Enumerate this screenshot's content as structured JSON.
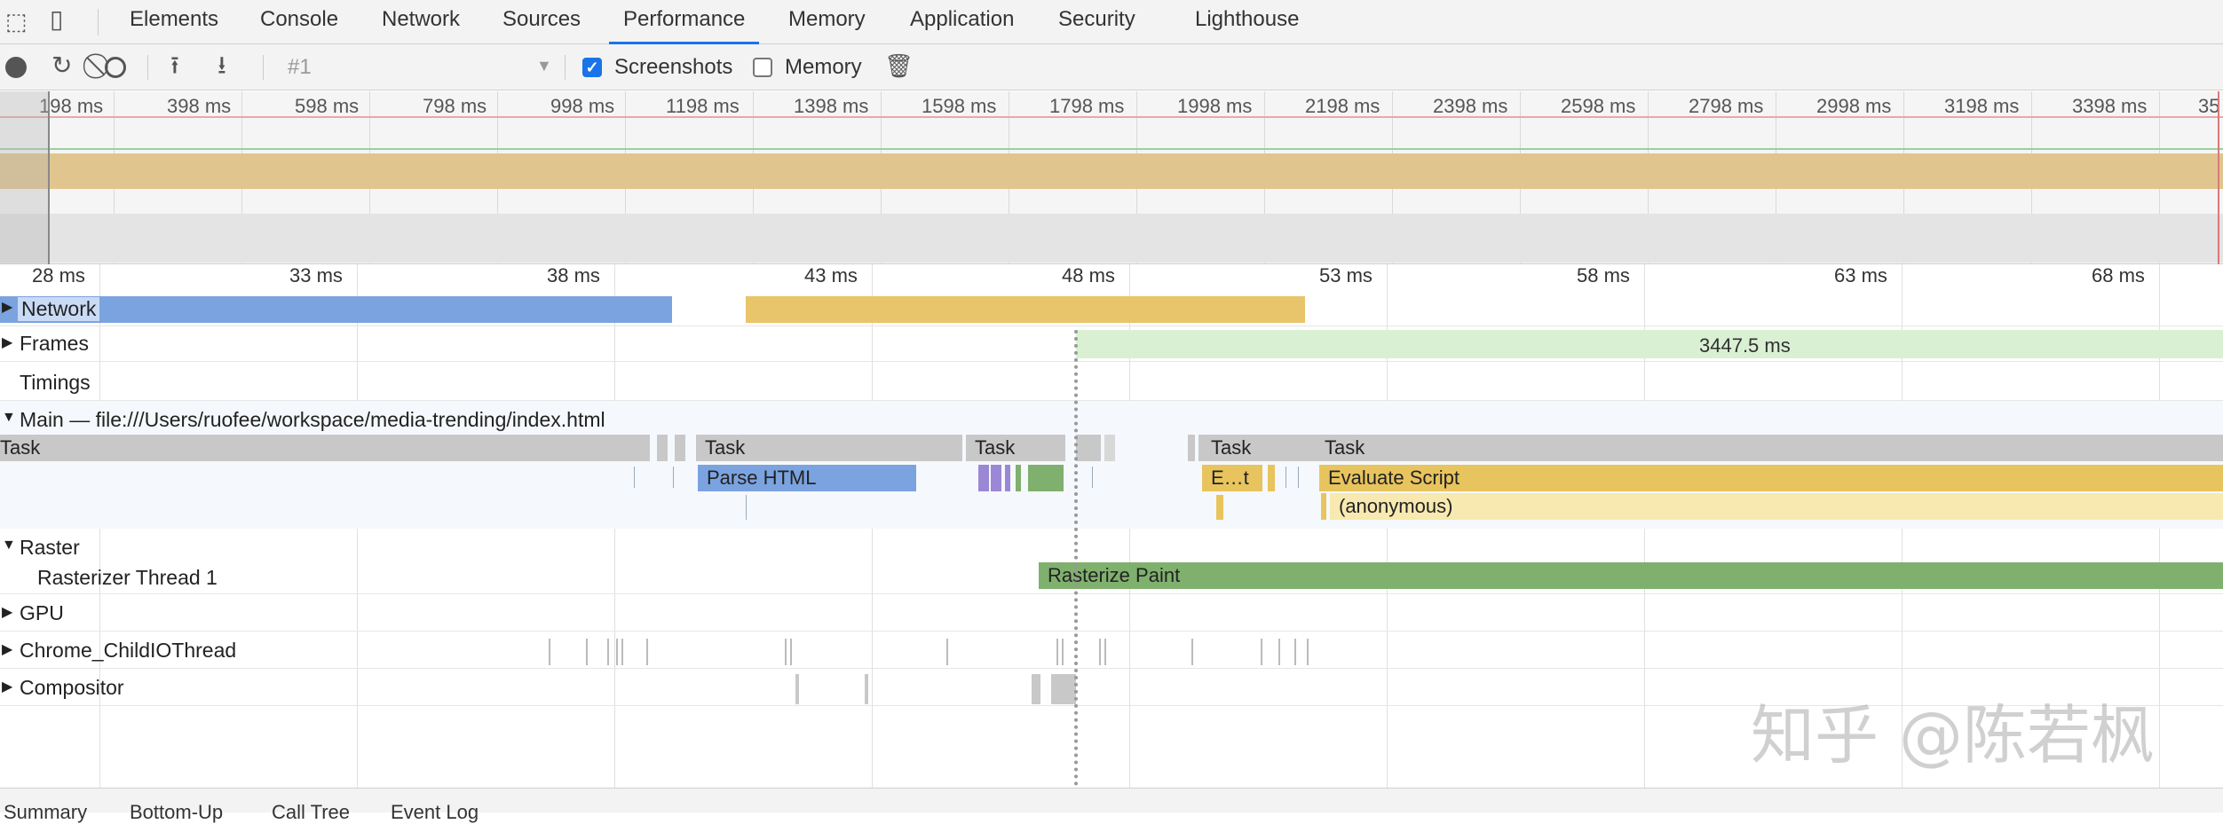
{
  "tabs": [
    "Elements",
    "Console",
    "Network",
    "Sources",
    "Performance",
    "Memory",
    "Application",
    "Security",
    "Lighthouse"
  ],
  "active_tab": "Performance",
  "toolbar": {
    "profile_select": "#1",
    "screenshots_label": "Screenshots",
    "screenshots_checked": true,
    "memory_label": "Memory",
    "memory_checked": false
  },
  "overview_ticks": [
    "198 ms",
    "398 ms",
    "598 ms",
    "798 ms",
    "998 ms",
    "1198 ms",
    "1398 ms",
    "1598 ms",
    "1798 ms",
    "1998 ms",
    "2198 ms",
    "2398 ms",
    "2598 ms",
    "2798 ms",
    "2998 ms",
    "3198 ms",
    "3398 ms",
    "35"
  ],
  "ticks": [
    "28 ms",
    "33 ms",
    "38 ms",
    "43 ms",
    "48 ms",
    "53 ms",
    "58 ms",
    "63 ms",
    "68 ms"
  ],
  "tracks": {
    "network": "Network",
    "frames": "Frames",
    "frames_duration": "3447.5 ms",
    "timings": "Timings",
    "main": "Main — file:///Users/ruofee/workspace/media-trending/index.html",
    "raster": "Raster",
    "rasterizer_thread": "Rasterizer Thread 1",
    "gpu": "GPU",
    "childio": "Chrome_ChildIOThread",
    "compositor": "Compositor"
  },
  "main_bars": {
    "task1": "Task",
    "task2": "Task",
    "task3": "Task",
    "task4": "Task",
    "task5": "Task",
    "parse_html": "Parse HTML",
    "et": "E…t",
    "evaluate_script": "Evaluate Script",
    "anonymous": "(anonymous)",
    "rasterize_paint": "Rasterize Paint"
  },
  "watermark": "知乎 @陈若枫",
  "bottom_tabs": [
    "Summary",
    "Bottom-Up",
    "Call Tree",
    "Event Log"
  ],
  "colors": {
    "network_blue": "#7ba3e0",
    "network_yellow": "#e8c46a",
    "frames_green": "#d9f0d3",
    "task_gray": "#c8c8c8",
    "parse_html": "#7ba3e0",
    "script_yellow": "#e8c45e",
    "script_light": "#f7e9b0",
    "raster_green": "#7fb06d",
    "accent": "#1a73e8"
  }
}
